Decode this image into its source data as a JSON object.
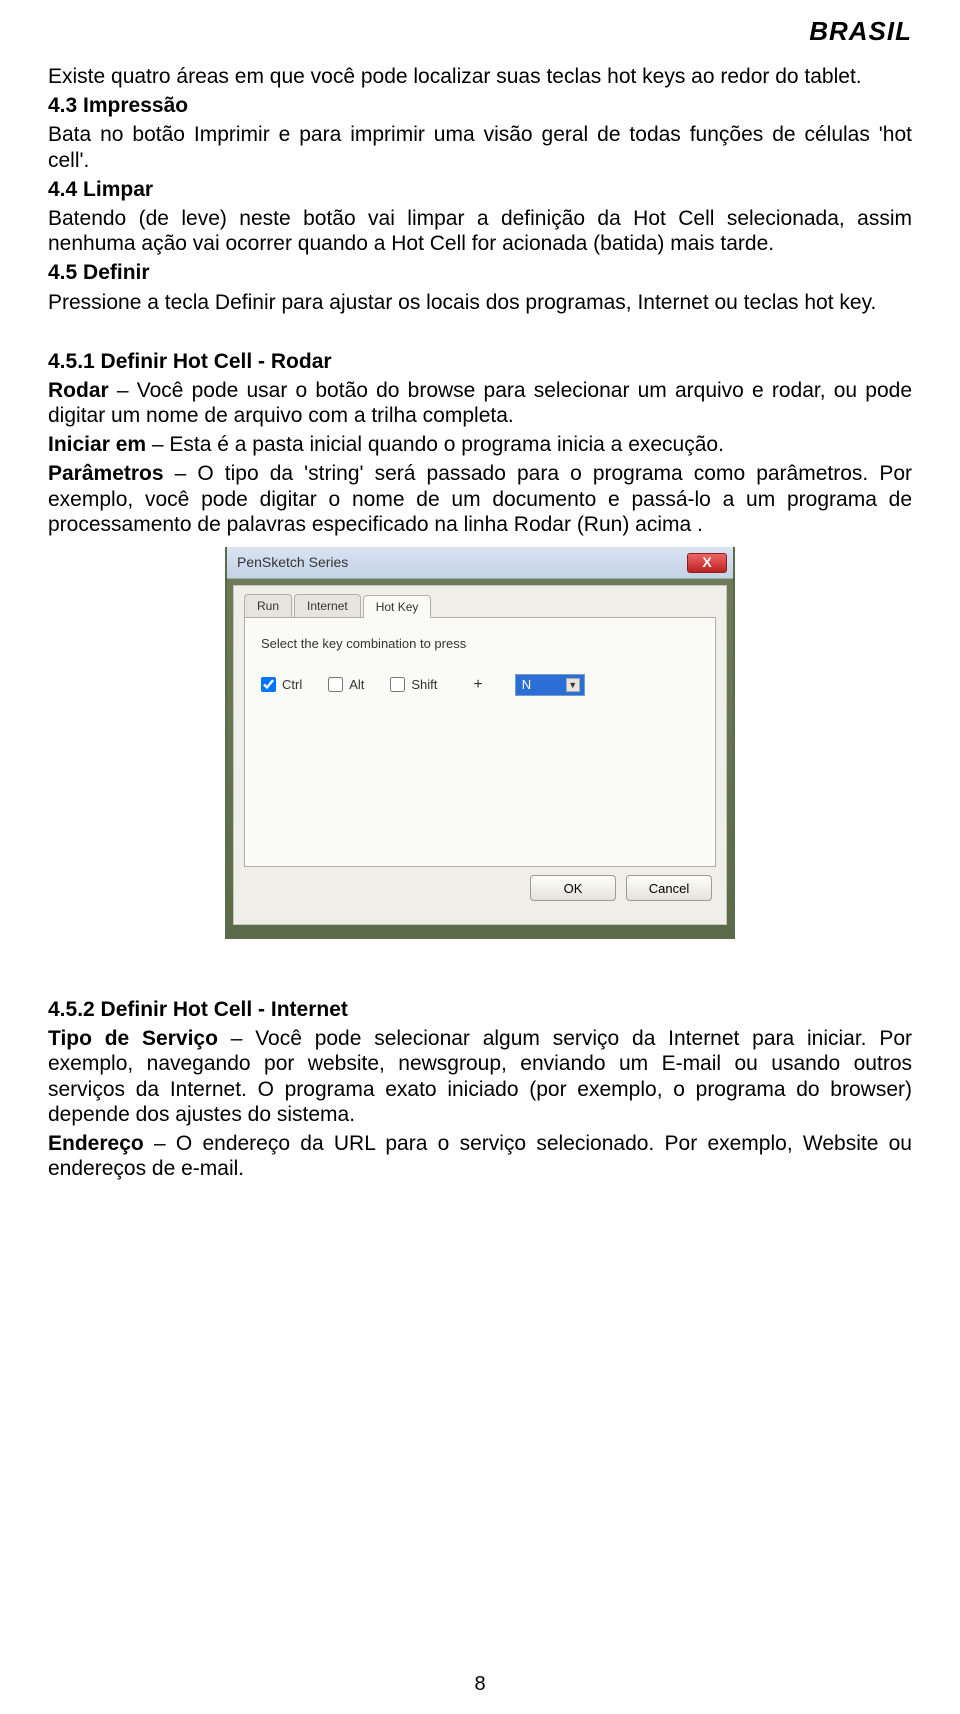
{
  "brand": "BRASIL",
  "intro": "Existe quatro áreas em que você pode localizar suas teclas hot keys ao redor do tablet.",
  "s43": {
    "title": "4.3 Impressão",
    "body": "Bata no botão Imprimir e para imprimir uma visão geral de todas funções de células 'hot cell'."
  },
  "s44": {
    "title": "4.4 Limpar",
    "body": "Batendo (de leve) neste botão vai limpar a definição da Hot Cell selecionada, assim nenhuma ação vai ocorrer quando a Hot Cell for acionada (batida) mais tarde."
  },
  "s45": {
    "title": "4.5 Definir",
    "body": "Pressione a tecla Definir para ajustar os locais dos programas, Internet ou teclas hot key."
  },
  "s451": {
    "title": "4.5.1 Definir Hot Cell - Rodar",
    "rodar_label": "Rodar",
    "rodar": " – Você pode usar o botão do browse para selecionar um arquivo e rodar, ou pode digitar um nome de arquivo com a trilha completa.",
    "iniciar_label": "Iniciar em",
    "iniciar": " – Esta é a pasta inicial quando o programa inicia a execução.",
    "parametros_label": "Parâmetros",
    "parametros": " – O tipo da 'string' será passado para o programa como parâmetros. Por exemplo, você pode digitar o nome de um documento e passá-lo a um programa de processamento de palavras especificado na linha Rodar (Run) acima ."
  },
  "dialog": {
    "title": "PenSketch Series",
    "tabs": {
      "run": "Run",
      "internet": "Internet",
      "hotkey": "Hot Key"
    },
    "instruction": "Select the key combination to press",
    "checks": {
      "ctrl": "Ctrl",
      "alt": "Alt",
      "shift": "Shift"
    },
    "ctrl_checked": true,
    "alt_checked": false,
    "shift_checked": false,
    "plus": "+",
    "combo_value": "N",
    "ok": "OK",
    "cancel": "Cancel",
    "close_glyph": "X"
  },
  "s452": {
    "title": "4.5.2 Definir Hot Cell - Internet",
    "tipo_label": "Tipo de Serviço",
    "tipo": " – Você pode selecionar algum serviço da Internet para iniciar. Por exemplo, navegando por website, newsgroup, enviando um E-mail ou usando outros serviços da Internet. O programa exato iniciado (por exemplo, o programa do browser) depende dos ajustes do sistema.",
    "endereco_label": "Endereço",
    "endereco": " – O endereço da URL para o serviço selecionado. Por exemplo, Website ou endereços de e-mail."
  },
  "page_number": "8"
}
